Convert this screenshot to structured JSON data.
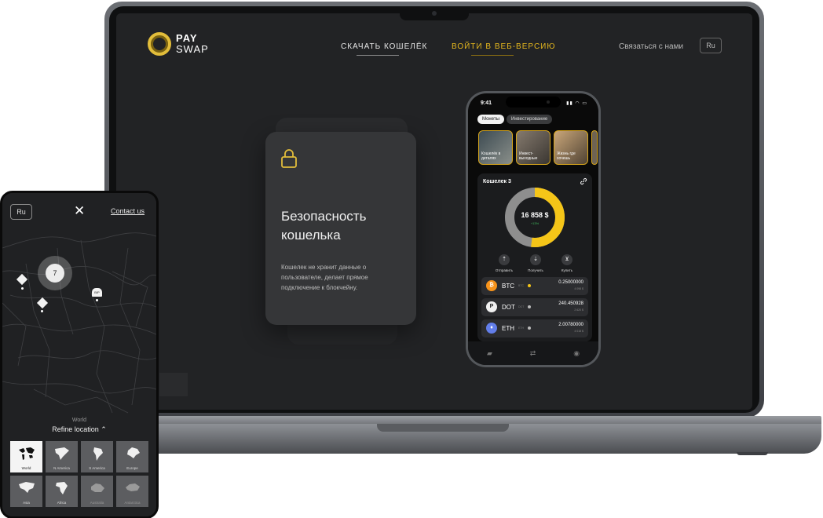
{
  "laptop_site": {
    "logo": {
      "line1": "PAY",
      "line2": "SWAP"
    },
    "nav": {
      "download": "СКАЧАТЬ КОШЕЛЁК",
      "web_version": "ВОЙТИ В ВЕБ-ВЕРСИЮ",
      "contact": "Связаться с нами",
      "lang": "Ru"
    },
    "card": {
      "title": "Безопасность кошелька",
      "description": "Кошелек не хранит данные о пользователе, делает прямое подключение к блокчейну."
    }
  },
  "phone": {
    "time": "9:41",
    "tabs": [
      "Монеты",
      "Инвестирование"
    ],
    "stories": [
      "Кошелёк в деталях",
      "Инвест-выходные",
      "Жизнь где хочешь"
    ],
    "wallet": {
      "title": "Кошелек 3",
      "total": "16 858 $",
      "change": "+13%",
      "donut": {
        "gold_fraction": 0.52,
        "gold": "#f5c518",
        "gray": "#8e8e8e"
      }
    },
    "actions": [
      "Отправить",
      "Получить",
      "Купить"
    ],
    "coins": [
      {
        "symbol": "BTC",
        "sub": "BTC",
        "amount": "0.25000000",
        "usd": "4 098 $",
        "color": "#f7931a",
        "icon": "₿"
      },
      {
        "symbol": "DOT",
        "sub": "DOT",
        "amount": "240.450928",
        "usd": "2 620 $",
        "color": "#4a4b4e",
        "icon": "P"
      },
      {
        "symbol": "ETH",
        "sub": "ETH",
        "amount": "2.00780000",
        "usd": "4 018 $",
        "color": "#627eea",
        "icon": "♦"
      }
    ]
  },
  "mobile": {
    "lang": "Ru",
    "contact": "Contact us",
    "cluster_count": "7",
    "pin_label": "BIP",
    "world_label": "World",
    "refine": "Refine location ⌃",
    "regions": [
      "World",
      "N America",
      "S America",
      "Europe",
      "Asia",
      "Africa",
      "Australia",
      "Antarctica"
    ]
  }
}
